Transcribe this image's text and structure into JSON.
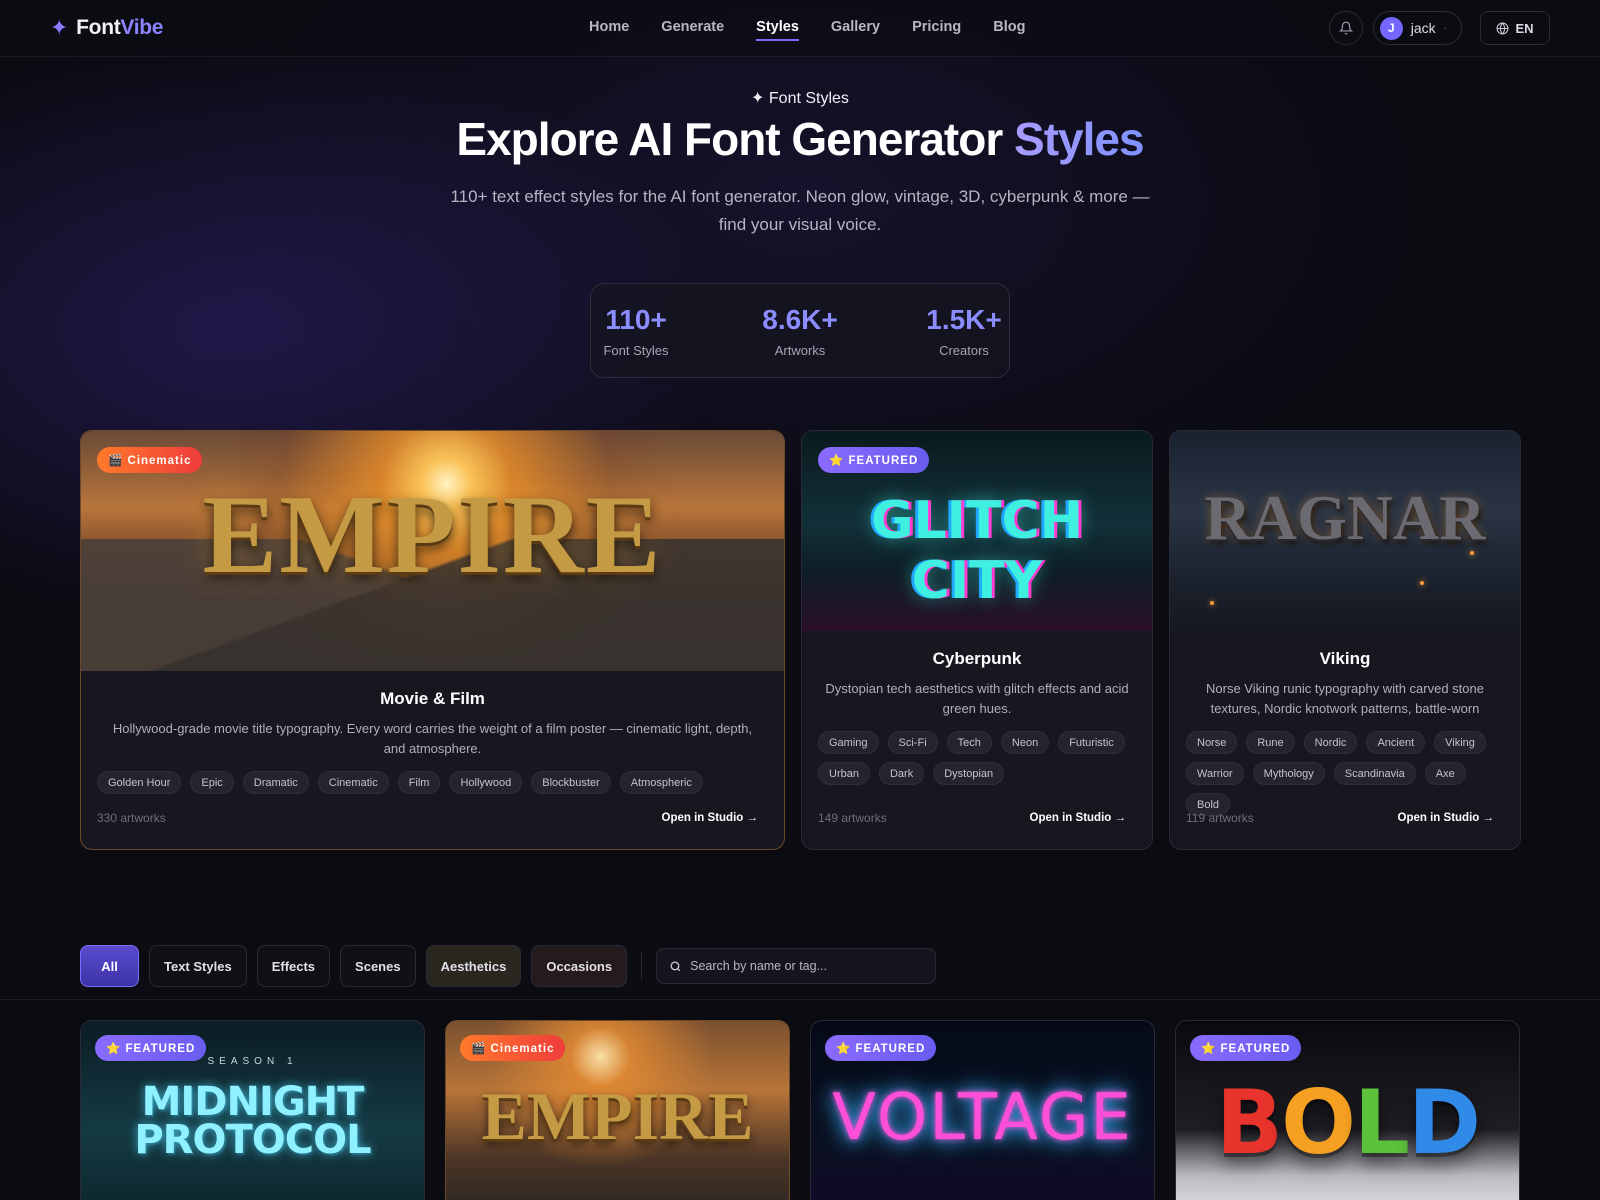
{
  "brand": {
    "star": "✦",
    "name_a": "Font",
    "name_b": "Vibe"
  },
  "nav": {
    "links": [
      "Home",
      "Generate",
      "Styles",
      "Gallery",
      "Pricing",
      "Blog"
    ],
    "active": "Styles",
    "user": {
      "initial": "J",
      "name": "jack",
      "caret": "·"
    },
    "lang": "EN"
  },
  "hero": {
    "eyebrow": "✦ Font Styles",
    "title_main": "Explore AI Font Generator ",
    "title_accent": "Styles",
    "subtitle": "110+ text effect styles for the AI font generator. Neon glow, vintage, 3D, cyberpunk & more — find your visual voice.",
    "stats": [
      {
        "value": "110+",
        "label": "Font Styles"
      },
      {
        "value": "8.6K+",
        "label": "Artworks"
      },
      {
        "value": "1.5K+",
        "label": "Creators"
      }
    ]
  },
  "featured": [
    {
      "badge": "🎬 Cinematic",
      "image_text": "EMPIRE",
      "title": "Movie & Film",
      "desc": "Hollywood-grade movie title typography. Every word carries the weight of a film poster — cinematic light, depth, and atmosphere.",
      "tags": [
        "Golden Hour",
        "Epic",
        "Dramatic",
        "Cinematic",
        "Film",
        "Hollywood",
        "Blockbuster",
        "Atmospheric"
      ],
      "count": "330 artworks",
      "open": "Open in Studio →"
    },
    {
      "badge": "⭐ FEATURED",
      "image_text": "GLITCH CITY",
      "title": "Cyberpunk",
      "desc": "Dystopian tech aesthetics with glitch effects and acid green hues.",
      "tags": [
        "Gaming",
        "Sci-Fi",
        "Tech",
        "Neon",
        "Futuristic",
        "Urban",
        "Dark",
        "Dystopian"
      ],
      "count": "149 artworks",
      "open": "Open in Studio →"
    },
    {
      "badge": "",
      "image_text": "RAGNAR",
      "title": "Viking",
      "desc": "Norse Viking runic typography with carved stone textures, Nordic knotwork patterns, battle-worn metal…",
      "tags": [
        "Norse",
        "Rune",
        "Nordic",
        "Ancient",
        "Viking",
        "Warrior",
        "Mythology",
        "Scandinavia",
        "Axe",
        "Bold"
      ],
      "count": "119 artworks",
      "open": "Open in Studio →"
    }
  ],
  "filters": {
    "chips": [
      "All",
      "Text Styles",
      "Effects",
      "Scenes",
      "Aesthetics",
      "Occasions"
    ],
    "active": "All",
    "search_placeholder": "Search by name or tag..."
  },
  "grid": [
    {
      "badge": "⭐ FEATURED",
      "kicker": "SEASON 1",
      "text_a": "MIDNIGHT",
      "text_b": "PROTOCOL"
    },
    {
      "badge": "🎬 Cinematic",
      "text_a": "EMPIRE"
    },
    {
      "badge": "⭐ FEATURED",
      "text_a": "VOLTAGE"
    },
    {
      "badge": "⭐ FEATURED",
      "letters": [
        "B",
        "O",
        "L",
        "D"
      ],
      "letter_colors": [
        "#e8342c",
        "#f5a021",
        "#5cc23a",
        "#2f8ae8"
      ]
    }
  ],
  "colors": {
    "accent": "#7d6bff",
    "stat": "#8a8cff",
    "cinematic_badge": "#ff7a2a",
    "featured_badge": "#8a6bff"
  }
}
